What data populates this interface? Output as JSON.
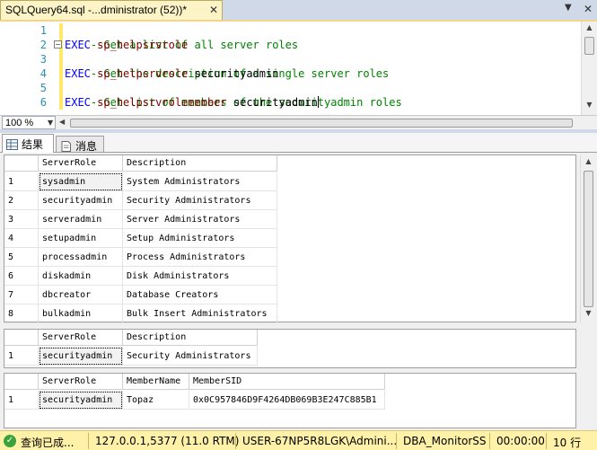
{
  "tab": {
    "title": "SQLQuery64.sql -...dministrator (52))*",
    "close_glyph": "✕",
    "dropdown_glyph": "▼",
    "window_close_glyph": "✕"
  },
  "editor": {
    "line_numbers": [
      "1",
      "2",
      "3",
      "4",
      "5",
      "6"
    ],
    "lines": [
      {
        "type": "comment",
        "text": "--Get a list of all server roles"
      },
      {
        "type": "exec",
        "kw": "EXEC",
        "proc": "sp_helpsrvrole",
        "arg": ""
      },
      {
        "type": "comment",
        "text": "--Get the description of a single server roles"
      },
      {
        "type": "exec",
        "kw": "EXEC",
        "proc": "sp_helpsrvrole",
        "arg": "securityadmin"
      },
      {
        "type": "comment",
        "text": "--Get list of members of the securityadmin roles"
      },
      {
        "type": "exec",
        "kw": "EXEC",
        "proc": "sp_helpsrvrolemember",
        "arg": "securityadmin"
      }
    ]
  },
  "zoom": {
    "value": "100 %"
  },
  "result_tabs": {
    "results_label": "结果",
    "messages_label": "消息"
  },
  "grid1": {
    "headers": [
      "ServerRole",
      "Description"
    ],
    "rows": [
      [
        "1",
        "sysadmin",
        "System Administrators"
      ],
      [
        "2",
        "securityadmin",
        "Security Administrators"
      ],
      [
        "3",
        "serveradmin",
        "Server Administrators"
      ],
      [
        "4",
        "setupadmin",
        "Setup Administrators"
      ],
      [
        "5",
        "processadmin",
        "Process Administrators"
      ],
      [
        "6",
        "diskadmin",
        "Disk Administrators"
      ],
      [
        "7",
        "dbcreator",
        "Database Creators"
      ],
      [
        "8",
        "bulkadmin",
        "Bulk Insert Administrators"
      ]
    ]
  },
  "grid2": {
    "headers": [
      "ServerRole",
      "Description"
    ],
    "rows": [
      [
        "1",
        "securityadmin",
        "Security Administrators"
      ]
    ]
  },
  "grid3": {
    "headers": [
      "ServerRole",
      "MemberName",
      "MemberSID"
    ],
    "rows": [
      [
        "1",
        "securityadmin",
        "Topaz",
        "0x0C957846D9F4264DB069B3E247C885B1"
      ]
    ]
  },
  "status": {
    "state": "查询已成...",
    "server": "127.0.0.1,5377 (11.0 RTM)",
    "user": "USER-67NP5R8LGK\\Admini...",
    "database": "DBA_MonitorSS",
    "elapsed": "00:00:00",
    "rows": "10 行"
  },
  "colors": {
    "status_bar": "#fff2a8",
    "comment": "#008000",
    "keyword": "#0000ff",
    "line_number": "#2b91af"
  }
}
